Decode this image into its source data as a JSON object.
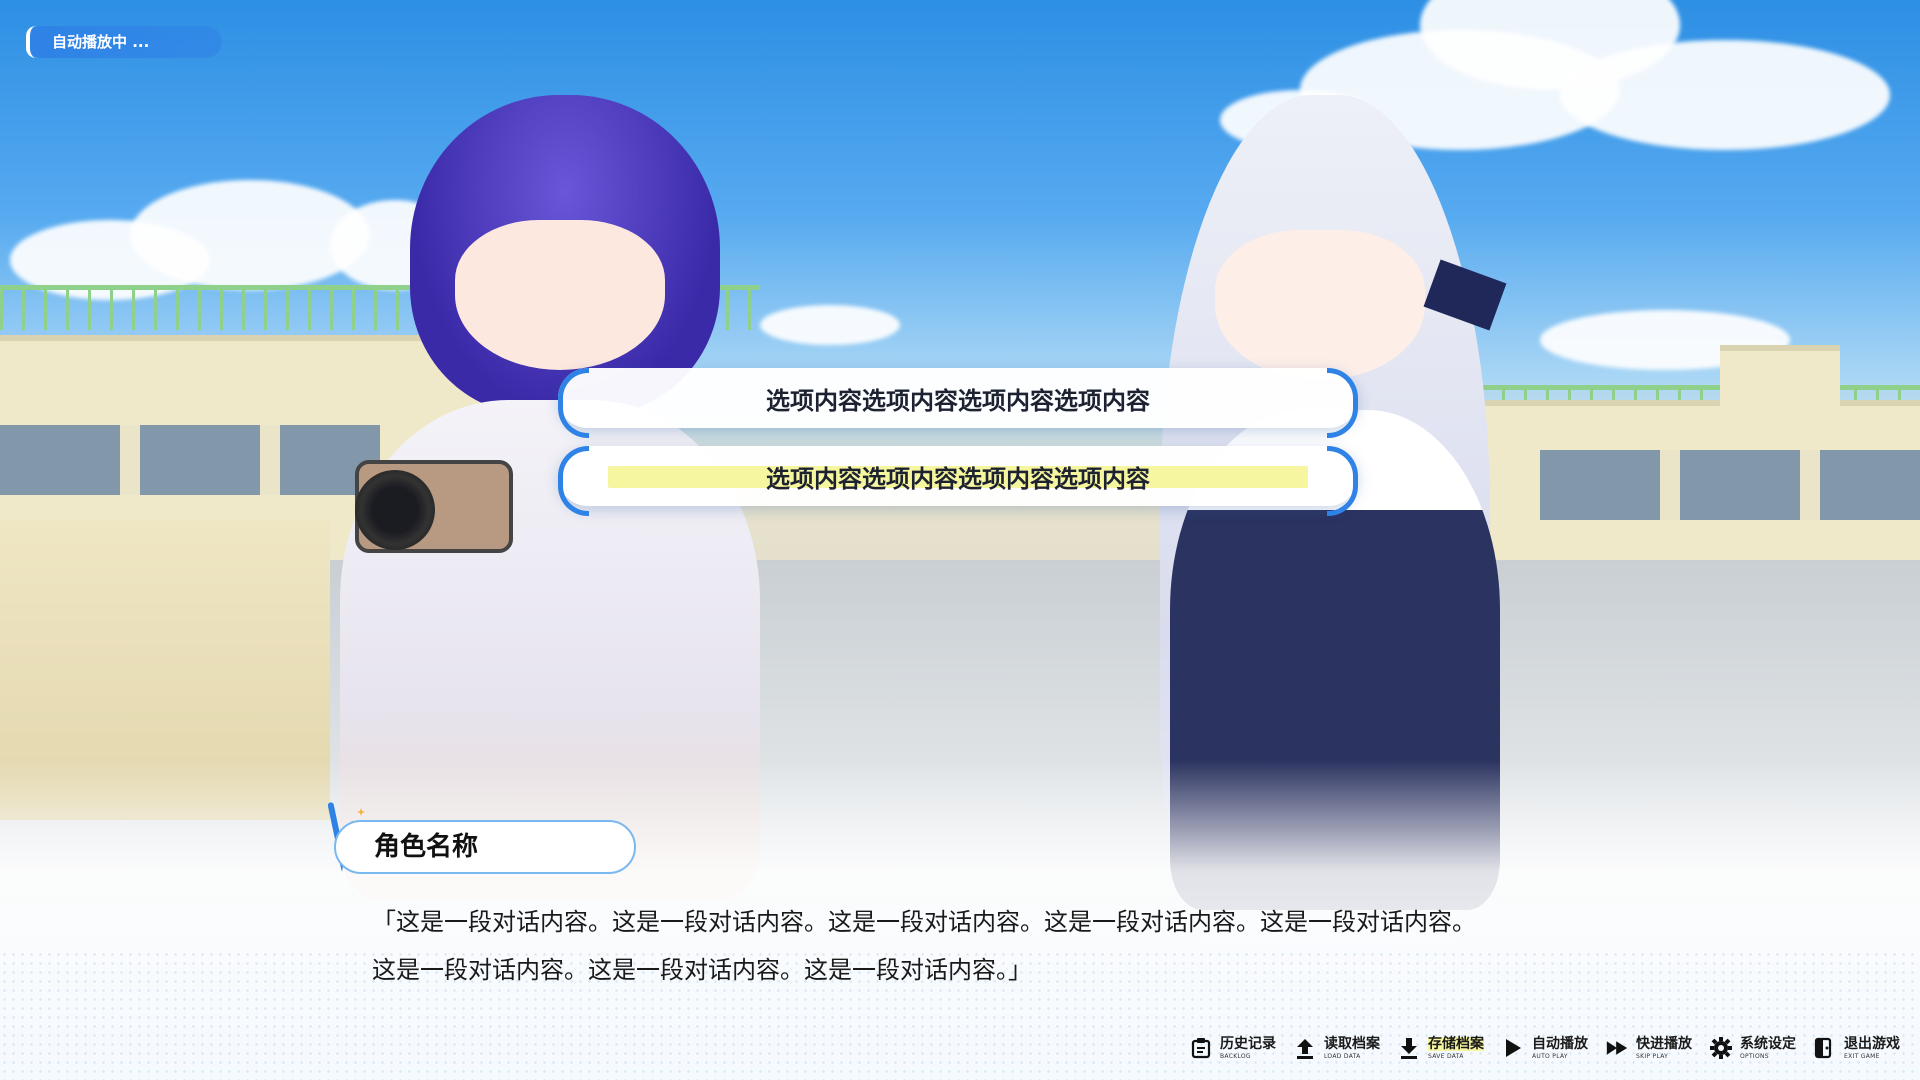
{
  "status": {
    "label": "自动播放中 ..."
  },
  "choices": [
    {
      "text": "选项内容选项内容选项内容选项内容",
      "highlighted": false
    },
    {
      "text": "选项内容选项内容选项内容选项内容",
      "highlighted": true
    }
  ],
  "speaker": {
    "name": "角色名称"
  },
  "dialogue": {
    "line1": "「这是一段对话内容。这是一段对话内容。这是一段对话内容。这是一段对话内容。这是一段对话内容。",
    "line2": "这是一段对话内容。这是一段对话内容。这是一段对话内容。」"
  },
  "menu": [
    {
      "zh": "历史记录",
      "en": "BACKLOG",
      "icon": "clipboard-icon"
    },
    {
      "zh": "读取档案",
      "en": "LOAD DATA",
      "icon": "upload-icon"
    },
    {
      "zh": "存储档案",
      "en": "SAVE DATA",
      "icon": "download-icon",
      "active": true
    },
    {
      "zh": "自动播放",
      "en": "AUTO PLAY",
      "icon": "play-icon"
    },
    {
      "zh": "快进播放",
      "en": "SKIP PLAY",
      "icon": "fast-forward-icon"
    },
    {
      "zh": "系统设定",
      "en": "OPTIONS",
      "icon": "gear-icon"
    },
    {
      "zh": "退出游戏",
      "en": "EXIT GAME",
      "icon": "exit-icon"
    }
  ],
  "colors": {
    "accent": "#2f82e6",
    "highlight": "#f7f6a0"
  }
}
